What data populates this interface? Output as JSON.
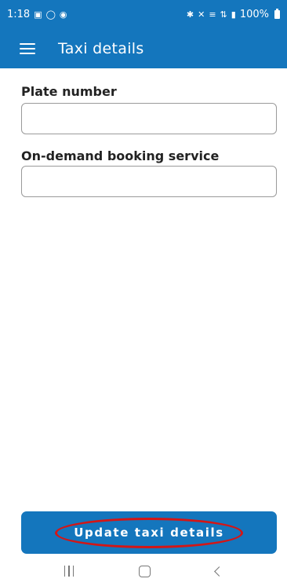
{
  "status_bar": {
    "time": "1:18",
    "left_icons": [
      "gallery-icon",
      "instagram-icon",
      "car-app-icon"
    ],
    "right_icons": [
      "bluetooth-icon",
      "mute-icon",
      "volte-icon",
      "4g-icon",
      "signal-icon"
    ],
    "battery_text": "100%"
  },
  "app_bar": {
    "title": "Taxi details"
  },
  "form": {
    "plate_label": "Plate number",
    "plate_value": "",
    "booking_label": "On-demand booking service",
    "booking_value": ""
  },
  "actions": {
    "update_label": "Update taxi details"
  },
  "colors": {
    "primary": "#1476bd",
    "highlight": "#d31616"
  }
}
